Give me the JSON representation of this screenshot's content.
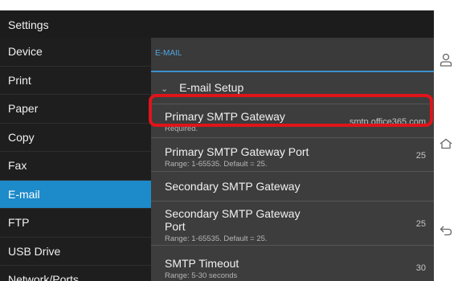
{
  "title": "Settings",
  "sidebar": {
    "items": [
      {
        "label": "Device"
      },
      {
        "label": "Print"
      },
      {
        "label": "Paper"
      },
      {
        "label": "Copy"
      },
      {
        "label": "Fax"
      },
      {
        "label": "E-mail"
      },
      {
        "label": "FTP"
      },
      {
        "label": "USB Drive"
      },
      {
        "label": "Network/Ports"
      }
    ]
  },
  "main": {
    "section": "E-MAIL",
    "group": "E-mail Setup",
    "rows": [
      {
        "title": "Primary SMTP Gateway",
        "sub": "Required.",
        "value": "smtp.office365.com"
      },
      {
        "title": "Primary SMTP Gateway Port",
        "sub": "Range: 1-65535. Default = 25.",
        "value": "25"
      },
      {
        "title": "Secondary SMTP Gateway"
      },
      {
        "title_line1": "Secondary SMTP Gateway",
        "title_line2": "Port",
        "sub": "Range: 1-65535. Default = 25.",
        "value": "25"
      },
      {
        "title": "SMTP Timeout",
        "sub": "Range: 5-30 seconds",
        "value": "30"
      }
    ]
  },
  "colors": {
    "accent": "#1d8ac9",
    "highlight": "#e0141b"
  },
  "nav_icons": [
    "user-icon",
    "home-icon",
    "back-icon"
  ]
}
